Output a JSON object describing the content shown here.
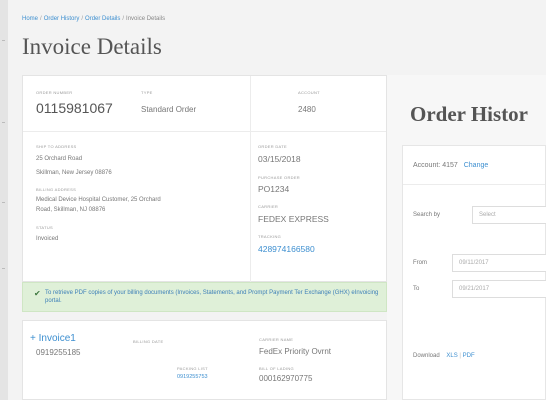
{
  "breadcrumb": {
    "items": [
      "Home",
      "Order History",
      "Order Details"
    ],
    "current": "Invoice Details",
    "separator": "/"
  },
  "page_title": "Invoice Details",
  "order": {
    "order_number_label": "ORDER NUMBER",
    "order_number": "0115981067",
    "type_label": "TYPE",
    "type": "Standard Order",
    "account_label": "ACCOUNT",
    "account": "2480",
    "ship_to_label": "SHIP TO ADDRESS",
    "ship_to_line1": "25 Orchard Road",
    "ship_to_line2": "Skillman, New Jersey 08876",
    "billing_label": "BILLING ADDRESS",
    "billing_line1": "Medical Device Hospital Customer, 25 Orchard",
    "billing_line2": "Road, Skillman, NJ 08876",
    "status_label": "STATUS",
    "status": "Invoiced",
    "order_date_label": "ORDER DATE",
    "order_date": "03/15/2018",
    "po_label": "PURCHASE ORDER",
    "po": "PO1234",
    "carrier_label": "CARRIER",
    "carrier": "FEDEX EXPRESS",
    "tracking_label": "TRACKING",
    "tracking": "428974166580"
  },
  "banner": {
    "icon": "check-icon",
    "text": "To retrieve PDF copies of your billing documents (Invoices, Statements, and Prompt Payment Ter Exchange (GHX) eInvoicing portal."
  },
  "invoice": {
    "title": "Invoice1",
    "expand_symbol": "+",
    "number": "0919255185",
    "billing_date_label": "BILLING DATE",
    "carrier_name_label": "CARRIER NAME",
    "carrier_name": "FedEx Priority Ovrnt",
    "packing_list_label": "PACKING LIST",
    "packing_list": "0919255753",
    "bill_of_lading_label": "BILL OF LADING",
    "bill_of_lading": "000162970775"
  },
  "history": {
    "title": "Order Histor",
    "account_label": "Account:",
    "account_value": "4157",
    "change_label": "Change",
    "search_by_label": "Search by",
    "search_by_value": "Select",
    "from_label": "From",
    "from_value": "09/11/2017",
    "to_label": "To",
    "to_value": "09/21/2017",
    "download_label": "Download",
    "xls_label": "XLS",
    "divider": "|",
    "pdf_label": "PDF"
  },
  "colors": {
    "link": "#3d8fd0",
    "banner_bg": "#dff0d8",
    "banner_check": "#3c763d"
  }
}
